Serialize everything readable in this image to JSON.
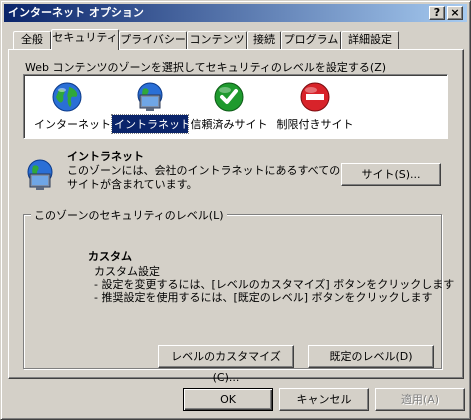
{
  "window": {
    "title": "インターネット オプション",
    "help_label": "?",
    "close_label": "×"
  },
  "tabs": [
    {
      "label": "全般"
    },
    {
      "label": "セキュリティ"
    },
    {
      "label": "プライバシー"
    },
    {
      "label": "コンテンツ"
    },
    {
      "label": "接続"
    },
    {
      "label": "プログラム"
    },
    {
      "label": "詳細設定"
    }
  ],
  "security": {
    "zone_prompt": "Web コンテンツのゾーンを選択してセキュリティのレベルを設定する(Z)",
    "zones": [
      {
        "label": "インターネット",
        "icon": "globe-icon"
      },
      {
        "label": "イントラネット",
        "icon": "network-computer-icon"
      },
      {
        "label": "信頼済みサイト",
        "icon": "green-check-icon"
      },
      {
        "label": "制限付きサイト",
        "icon": "red-forbidden-icon"
      }
    ],
    "selected_zone_title": "イントラネット",
    "selected_zone_desc_1": "このゾーンには、会社のイントラネットにあるすべての Web",
    "selected_zone_desc_2": "サイトが含まれています。",
    "sites_button": "サイト(S)...",
    "level_group_title": "このゾーンのセキュリティのレベル(L)",
    "level_heading": "カスタム",
    "level_line_1": "カスタム設定",
    "level_line_2": "- 設定を変更するには、[レベルのカスタマイズ] ボタンをクリックします",
    "level_line_3": "- 推奨設定を使用するには、[既定のレベル] ボタンをクリックします",
    "customize_button": "レベルのカスタマイズ(C)...",
    "default_level_button": "既定のレベル(D)"
  },
  "footer": {
    "ok": "OK",
    "cancel": "キャンセル",
    "apply": "適用(A)"
  }
}
